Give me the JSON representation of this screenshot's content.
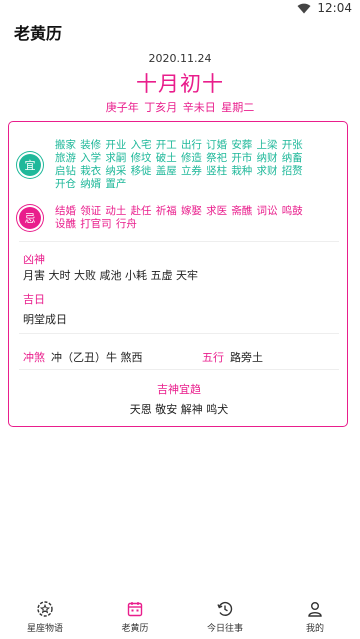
{
  "status_bar": {
    "time": "12:04",
    "icons": [
      "wifi-icon",
      "battery-icon"
    ]
  },
  "app": {
    "title": "老黄历"
  },
  "date": {
    "gregorian": "2020.11.24",
    "lunar": "十月初十",
    "ganzhi": "庚子年 丁亥月 辛未日 星期二"
  },
  "yi": {
    "badge": "宜",
    "items": [
      "搬家",
      "装修",
      "开业",
      "入宅",
      "开工",
      "出行",
      "订婚",
      "安葬",
      "上梁",
      "开张",
      "旅游",
      "入学",
      "求嗣",
      "修坟",
      "破土",
      "修造",
      "祭祀",
      "开市",
      "纳财",
      "纳畜",
      "启钻",
      "栽衣",
      "纳采",
      "移徙",
      "盖屋",
      "立券",
      "竖柱",
      "栽种",
      "求财",
      "招赘",
      "开仓",
      "纳婿",
      "置产"
    ]
  },
  "ji": {
    "badge": "忌",
    "items": [
      "结婚",
      "领证",
      "动土",
      "赴任",
      "祈福",
      "嫁娶",
      "求医",
      "斋醮",
      "词讼",
      "鸣鼓",
      "设醮",
      "打官司",
      "行舟"
    ]
  },
  "xiongshen": {
    "label": "凶神",
    "text": "月害 大时 大败 咸池 小耗 五虚 天牢"
  },
  "jiri": {
    "label": "吉日",
    "text": "明堂成日"
  },
  "chongsha": {
    "label": "冲煞",
    "text": "冲（乙丑）牛 煞西"
  },
  "wuxing": {
    "label": "五行",
    "text": "路旁土"
  },
  "jishen": {
    "label": "吉神宜趋",
    "text": "天恩 敬安 解神 鸣犬"
  },
  "colors": {
    "accent": "#e91e8c",
    "yi_green": "#1fb89a"
  },
  "nav": [
    {
      "label": "星座物语",
      "icon": "star-gear-icon"
    },
    {
      "label": "老黄历",
      "icon": "calendar-icon"
    },
    {
      "label": "今日往事",
      "icon": "history-clock-icon"
    },
    {
      "label": "我的",
      "icon": "user-icon"
    }
  ]
}
